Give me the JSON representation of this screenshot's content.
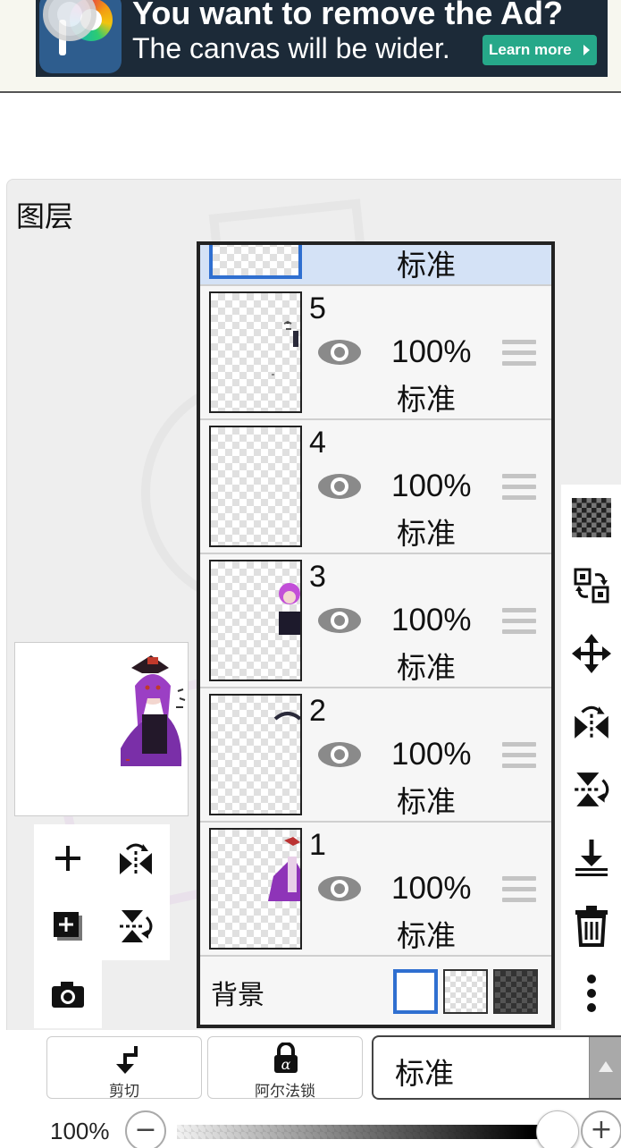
{
  "ad": {
    "headline": "You want to remove the Ad?",
    "subline": "The canvas will be wider.",
    "learn_more": "Learn more",
    "accent": "#26a889"
  },
  "panel": {
    "title": "图层"
  },
  "layers": [
    {
      "name": "",
      "opacity": "",
      "blend": "标准",
      "selected": true,
      "visible": true
    },
    {
      "name": "5",
      "opacity": "100%",
      "blend": "标准",
      "selected": false,
      "visible": true
    },
    {
      "name": "4",
      "opacity": "100%",
      "blend": "标准",
      "selected": false,
      "visible": true
    },
    {
      "name": "3",
      "opacity": "100%",
      "blend": "标准",
      "selected": false,
      "visible": true
    },
    {
      "name": "2",
      "opacity": "100%",
      "blend": "标准",
      "selected": false,
      "visible": true
    },
    {
      "name": "1",
      "opacity": "100%",
      "blend": "标准",
      "selected": false,
      "visible": true
    }
  ],
  "background_row": {
    "label": "背景",
    "options": [
      "white",
      "transparent",
      "dark-checker"
    ],
    "selected": "white"
  },
  "left_tools": [
    "add-layer-icon",
    "flip-horizontal-icon",
    "add-copy-layer-icon",
    "flip-vertical-icon",
    "camera-icon"
  ],
  "right_tools": [
    "checker-icon",
    "transform-layer-icon",
    "move-icon",
    "flip-horizontal-icon",
    "flip-vertical-icon",
    "merge-down-icon",
    "trash-icon",
    "more-icon"
  ],
  "bottom": {
    "clip_label": "剪切",
    "alpha_lock_label": "阿尔法锁",
    "blend_mode": "标准",
    "opacity_label": "100%",
    "opacity_value": 1.0
  },
  "colors": {
    "selection_blue": "#2f6fd0",
    "selected_row": "#d4e2f6",
    "panel_bg": "#eeeeee"
  }
}
